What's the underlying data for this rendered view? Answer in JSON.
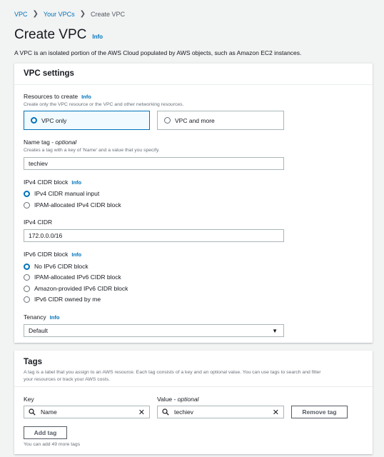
{
  "breadcrumb": {
    "items": [
      "VPC",
      "Your VPCs",
      "Create VPC"
    ]
  },
  "page": {
    "title": "Create VPC",
    "info": "Info",
    "description": "A VPC is an isolated portion of the AWS Cloud populated by AWS objects, such as Amazon EC2 instances."
  },
  "vpc_settings": {
    "heading": "VPC settings",
    "resources": {
      "label": "Resources to create",
      "info": "Info",
      "hint": "Create only the VPC resource or the VPC and other networking resources.",
      "options": [
        "VPC only",
        "VPC and more"
      ],
      "selected": "VPC only"
    },
    "name_tag": {
      "label": "Name tag - ",
      "optional": "optional",
      "hint": "Creates a tag with a key of 'Name' and a value that you specify.",
      "value": "techiev"
    },
    "ipv4_block": {
      "label": "IPv4 CIDR block",
      "info": "Info",
      "options": [
        "IPv4 CIDR manual input",
        "IPAM-allocated IPv4 CIDR block"
      ],
      "selected": "IPv4 CIDR manual input"
    },
    "ipv4_cidr": {
      "label": "IPv4 CIDR",
      "value": "172.0.0.0/16"
    },
    "ipv6_block": {
      "label": "IPv6 CIDR block",
      "info": "Info",
      "options": [
        "No IPv6 CIDR block",
        "IPAM-allocated IPv6 CIDR block",
        "Amazon-provided IPv6 CIDR block",
        "IPv6 CIDR owned by me"
      ],
      "selected": "No IPv6 CIDR block"
    },
    "tenancy": {
      "label": "Tenancy",
      "info": "Info",
      "value": "Default"
    }
  },
  "tags": {
    "heading": "Tags",
    "description": "A tag is a label that you assign to an AWS resource. Each tag consists of a key and an optional value. You can use tags to search and filter",
    "description_line2": "your resources or track your AWS costs.",
    "key_label": "Key",
    "value_label": "Value - ",
    "value_optional": "optional",
    "key_value": "Name",
    "value_value": "techiev",
    "remove_label": "Remove tag",
    "add_label": "Add tag",
    "remaining": "You can add 49 more tags"
  },
  "colors": {
    "accent": "#0073bb",
    "background": "#f2f3f3"
  },
  "icons": [
    "chevron-right-icon",
    "search-icon",
    "clear-icon",
    "caret-down-icon"
  ]
}
